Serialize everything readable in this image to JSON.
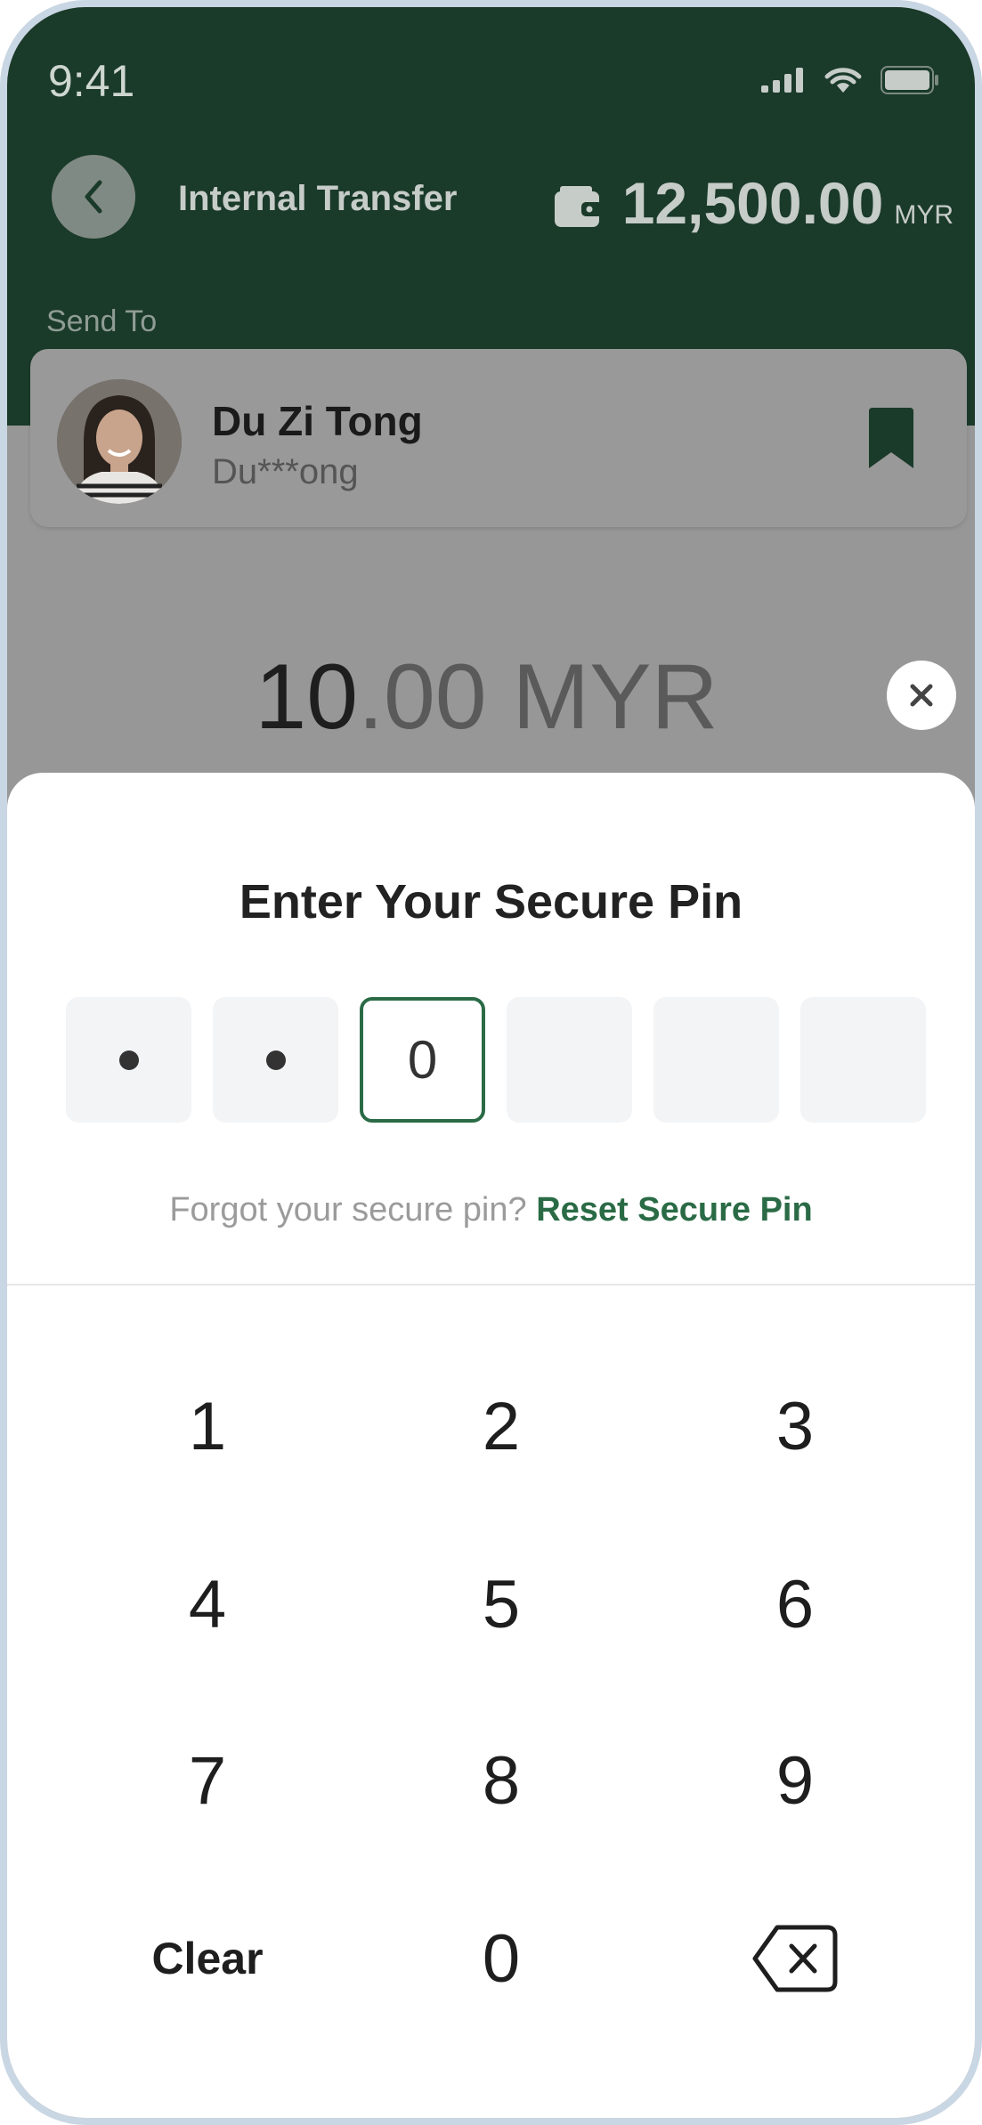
{
  "status_bar": {
    "time": "9:41"
  },
  "header": {
    "title": "Internal Transfer",
    "balance_amount": "12,500.00",
    "balance_currency": "MYR"
  },
  "send_to": {
    "label": "Send To",
    "recipient_name": "Du Zi Tong",
    "recipient_account": "Du***ong"
  },
  "amount": {
    "whole": "10",
    "decimal": ".00 MYR"
  },
  "pin_sheet": {
    "title": "Enter Your Secure Pin",
    "pin_current_digit": "0",
    "forgot_text": "Forgot your secure pin?",
    "reset_link": "Reset Secure Pin"
  },
  "keypad": {
    "keys": [
      "1",
      "2",
      "3",
      "4",
      "5",
      "6",
      "7",
      "8",
      "9"
    ],
    "clear_label": "Clear",
    "zero_label": "0"
  },
  "colors": {
    "header_green": "#1a3a2a",
    "accent_green": "#2a6b46",
    "frame": "#c9d6e3"
  }
}
